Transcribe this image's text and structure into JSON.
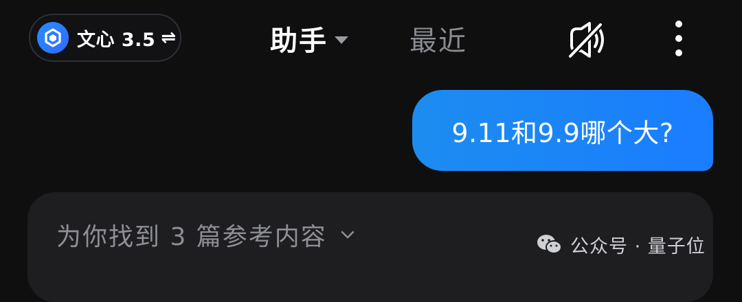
{
  "header": {
    "model_label": "文心 3.5",
    "swap_icon": "⇌",
    "assistant_tab_label": "助手",
    "recent_tab_label": "最近",
    "icons": [
      "model-logo-icon",
      "caret-down-icon",
      "voice-off-icon",
      "more-vertical-icon"
    ]
  },
  "conversation": {
    "user_message": "9.11和9.9哪个大?",
    "references_label": "为你找到 3 篇参考内容"
  },
  "watermark": {
    "text": "公众号 · 量子位",
    "icon": "wechat-icon"
  },
  "colors": {
    "background": "#0f0f10",
    "bubble": "#1a7dff",
    "card": "#1e1e21",
    "muted_text": "#8e8f95"
  }
}
